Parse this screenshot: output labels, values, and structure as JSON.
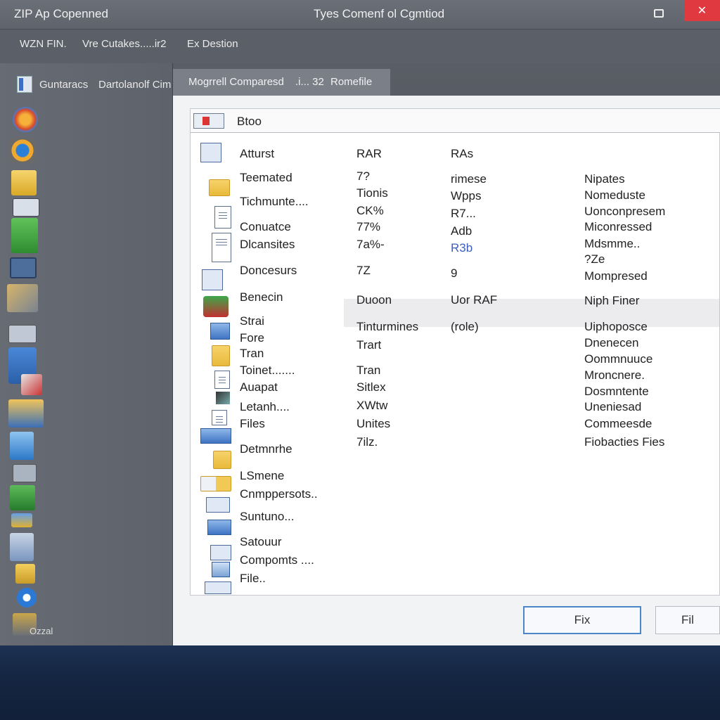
{
  "titlebar": {
    "app_title": "ZIP Ap Copenned",
    "window_title": "Tyes Comenf ol Cgmtiod",
    "close_label": "✕"
  },
  "menubar": {
    "items": [
      "WZN FIN.",
      "Vre Cutakes.....ir2",
      "Ex Destion"
    ]
  },
  "sidebar": {
    "tab_labels": [
      "Guntaracs",
      "Dartolanolf Cim"
    ],
    "footer_label": "Ozzal"
  },
  "main_tab": {
    "left": "Mogrrell Comparesd",
    "mid": ".i... 32",
    "right": "Romefile"
  },
  "filelist": {
    "header_label": "Btoo",
    "rows": [
      {
        "name": "Atturst",
        "c2": "RAR",
        "c3": "RAs",
        "c4": ""
      },
      {
        "name": "Teemated",
        "c2": "7?",
        "c3": "rimese",
        "c4": "Nipates"
      },
      {
        "name": "Tichmunte....",
        "c2": "Tionis",
        "c3": "Wpps",
        "c4": "Nomeduste"
      },
      {
        "name": "",
        "c2": "CK%",
        "c3": "R7...",
        "c4": "Uonconpresem"
      },
      {
        "name": "Conuatce",
        "c2": "77%",
        "c3": "Adb",
        "c4": "Miconressed"
      },
      {
        "name": "Dlcansites",
        "c2": "7a%-",
        "c3": "R3b",
        "c4": "Mdsmme.."
      },
      {
        "name": "",
        "c2": "",
        "c3": "",
        "c4": "?Ze"
      },
      {
        "name": "Doncesurs",
        "c2": "7Z",
        "c3": "9",
        "c4": "Mompresed"
      },
      {
        "name": "Benecin",
        "c2": "Duoon",
        "c3": "Uor RAF",
        "c4": "Niph Finer"
      },
      {
        "name": "Strai",
        "c2": "Tinturmines",
        "c3": "(role)",
        "c4": "Uiphoposce"
      },
      {
        "name": "Fore",
        "c2": "Trart",
        "c3": "",
        "c4": "Dnenecen"
      },
      {
        "name": "Tran",
        "c2": "",
        "c3": "",
        "c4": "Oommnuuce"
      },
      {
        "name": "Toinet.......",
        "c2": "Tran",
        "c3": "",
        "c4": "Mroncnere."
      },
      {
        "name": "Auapat",
        "c2": "Sitlex",
        "c3": "",
        "c4": "Dosmntente"
      },
      {
        "name": "Letanh....",
        "c2": "XWtw",
        "c3": "",
        "c4": "Uneniesad"
      },
      {
        "name": "Files",
        "c2": "Unites",
        "c3": "",
        "c4": "Commeesde"
      },
      {
        "name": "Detmnrhe",
        "c2": "7ilz.",
        "c3": "",
        "c4": "Fiobacties Fies"
      },
      {
        "name": "LSmene",
        "c2": "",
        "c3": "",
        "c4": ""
      },
      {
        "name": "Cnmppersots..",
        "c2": "",
        "c3": "",
        "c4": ""
      },
      {
        "name": "Suntuno...",
        "c2": "",
        "c3": "",
        "c4": ""
      },
      {
        "name": "Satouur",
        "c2": "",
        "c3": "",
        "c4": ""
      },
      {
        "name": "Compomts ....",
        "c2": "",
        "c3": "",
        "c4": ""
      },
      {
        "name": "File..",
        "c2": "",
        "c3": "",
        "c4": ""
      }
    ]
  },
  "buttons": {
    "primary": "Fix",
    "secondary": "Fil"
  }
}
